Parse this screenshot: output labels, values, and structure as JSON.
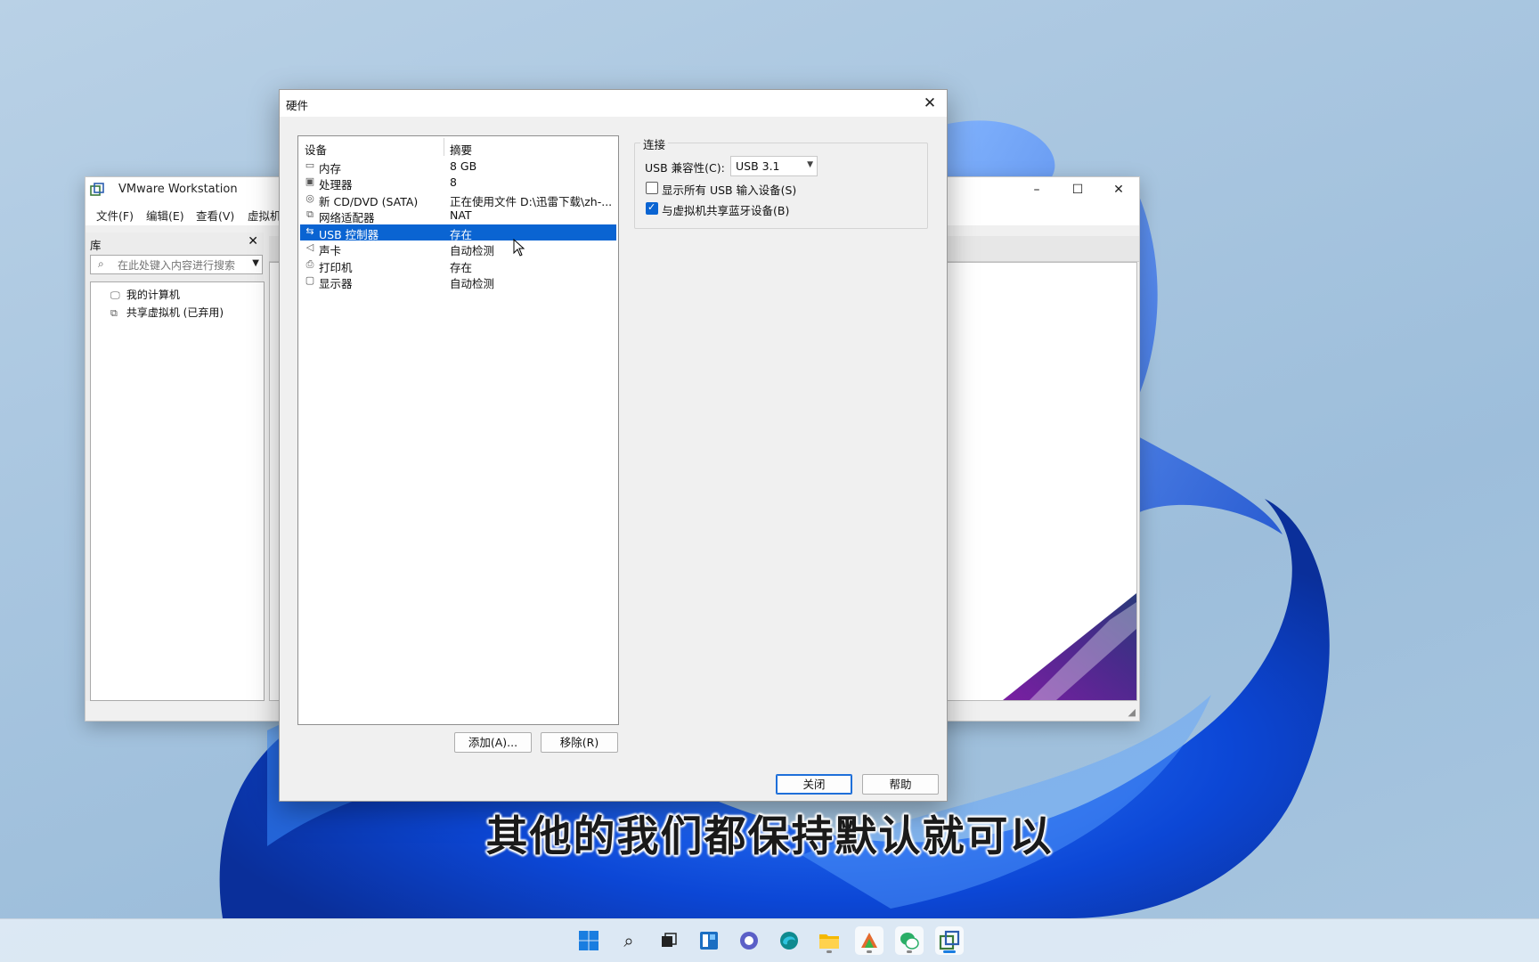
{
  "vmware": {
    "title": "VMware Workstation",
    "menu": [
      "文件(F)",
      "编辑(E)",
      "查看(V)",
      "虚拟机"
    ],
    "library": {
      "title": "库",
      "search_placeholder": "在此处键入内容进行搜索",
      "tree": [
        {
          "label": "我的计算机",
          "icon": "computer-icon"
        },
        {
          "label": "共享虚拟机 (已弃用)",
          "icon": "shared-vm-icon"
        }
      ]
    }
  },
  "dialog": {
    "title": "硬件",
    "columns": {
      "device": "设备",
      "summary": "摘要"
    },
    "devices": [
      {
        "name": "内存",
        "summary": "8 GB",
        "icon": "memory-icon"
      },
      {
        "name": "处理器",
        "summary": "8",
        "icon": "processor-icon"
      },
      {
        "name": "新 CD/DVD (SATA)",
        "summary": "正在使用文件 D:\\迅雷下载\\zh-...",
        "icon": "cd-dvd-icon"
      },
      {
        "name": "网络适配器",
        "summary": "NAT",
        "icon": "network-icon"
      },
      {
        "name": "USB 控制器",
        "summary": "存在",
        "icon": "usb-icon",
        "selected": true
      },
      {
        "name": "声卡",
        "summary": "自动检测",
        "icon": "speaker-icon"
      },
      {
        "name": "打印机",
        "summary": "存在",
        "icon": "printer-icon"
      },
      {
        "name": "显示器",
        "summary": "自动检测",
        "icon": "monitor-icon"
      }
    ],
    "buttons": {
      "add": "添加(A)...",
      "remove": "移除(R)",
      "close": "关闭",
      "help": "帮助"
    },
    "connection": {
      "group_label": "连接",
      "usb_compat_label": "USB 兼容性(C):",
      "usb_compat_value": "USB 3.1",
      "show_all_usb": {
        "label": "显示所有 USB 输入设备(S)",
        "checked": false
      },
      "share_bluetooth": {
        "label": "与虚拟机共享蓝牙设备(B)",
        "checked": true
      }
    }
  },
  "subtitle": "其他的我们都保持默认就可以",
  "taskbar": {
    "icons": [
      "windows-start-icon",
      "search-icon",
      "task-view-icon",
      "widgets-icon",
      "chat-icon",
      "edge-icon",
      "file-explorer-icon",
      "app-icon",
      "wechat-icon",
      "vmware-icon"
    ]
  },
  "colors": {
    "selection": "#0a64d2",
    "accent": "#1e6fd9"
  }
}
